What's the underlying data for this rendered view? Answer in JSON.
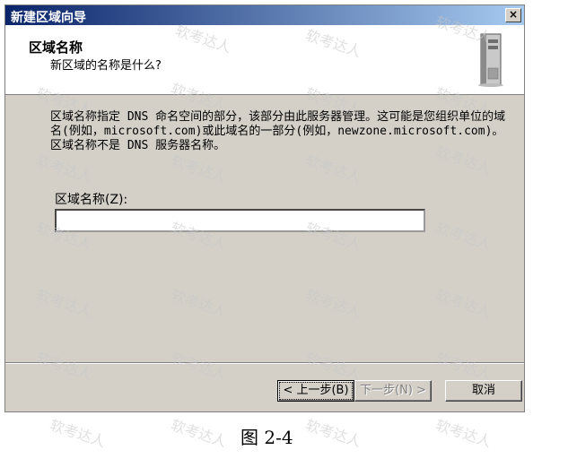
{
  "dialog": {
    "title": "新建区域向导",
    "close_label": "×"
  },
  "header": {
    "title": "区域名称",
    "subtitle": "新区域的名称是什么?",
    "icon": "server-tower-icon"
  },
  "content": {
    "description": "区域名称指定 DNS 命名空间的部分，该部分由此服务器管理。这可能是您组织单位的域名(例如，microsoft.com)或此域名的一部分(例如，newzone.microsoft.com)。区域名称不是 DNS 服务器名称。",
    "field_label": "区域名称(Z):",
    "field_value": ""
  },
  "buttons": {
    "back": "< 上一步(B)",
    "next": "下一步(N) >",
    "cancel": "取消"
  },
  "caption": "图 2-4",
  "watermark": "软考达人"
}
